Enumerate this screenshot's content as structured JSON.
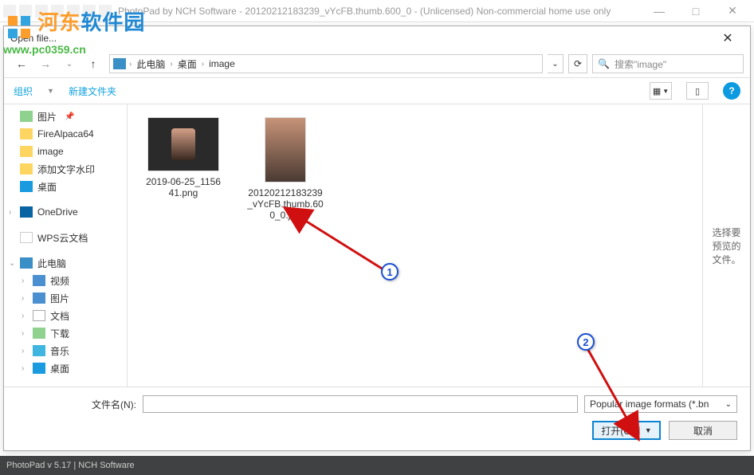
{
  "app_title": "PhotoPad by NCH Software - 20120212183239_vYcFB.thumb.600_0 - (Unlicensed) Non-commercial home use only",
  "watermark": {
    "brand_cn": "河东软件园",
    "url": "www.pc0359.cn"
  },
  "dialog": {
    "title": "Open file...",
    "breadcrumb": {
      "root": "此电脑",
      "p1": "桌面",
      "p2": "image"
    },
    "search_placeholder": "搜索\"image\"",
    "toolbar": {
      "organize": "组织",
      "newfolder": "新建文件夹"
    },
    "sidebar": {
      "items": [
        {
          "label": "图片",
          "ico": "folder-green",
          "pin": true,
          "exp": ""
        },
        {
          "label": "FireAlpaca64",
          "ico": "folder"
        },
        {
          "label": "image",
          "ico": "folder"
        },
        {
          "label": "添加文字水印",
          "ico": "folder"
        },
        {
          "label": "桌面",
          "ico": "desktop"
        },
        {
          "label": "",
          "ico": "",
          "spacer": true
        },
        {
          "label": "OneDrive",
          "ico": "onedrive",
          "exp": "›"
        },
        {
          "label": "",
          "ico": "",
          "spacer": true
        },
        {
          "label": "WPS云文档",
          "ico": "wps"
        },
        {
          "label": "",
          "ico": "",
          "spacer": true
        },
        {
          "label": "此电脑",
          "ico": "pc",
          "exp": "⌄"
        },
        {
          "label": "视频",
          "ico": "video",
          "indent": true,
          "exp": "›"
        },
        {
          "label": "图片",
          "ico": "pic2",
          "indent": true,
          "exp": "›"
        },
        {
          "label": "文档",
          "ico": "doc",
          "indent": true,
          "exp": "›"
        },
        {
          "label": "下载",
          "ico": "dl",
          "indent": true,
          "exp": "›"
        },
        {
          "label": "音乐",
          "ico": "music",
          "indent": true,
          "exp": "›"
        },
        {
          "label": "桌面",
          "ico": "desktop",
          "indent": true,
          "exp": "›"
        }
      ]
    },
    "files": [
      {
        "name": "2019-06-25_115641.png"
      },
      {
        "name": "20120212183239_vYcFB.thumb.600_0.jpg"
      }
    ],
    "preview_text": "选择要预览的文件。",
    "filename_label": "文件名(N):",
    "filename_value": "",
    "filter": "Popular image formats (*.bn",
    "open_btn": "打开(O)",
    "cancel_btn": "取消"
  },
  "annotations": {
    "b1": "1",
    "b2": "2"
  },
  "status": "PhotoPad v 5.17  |  NCH Software"
}
